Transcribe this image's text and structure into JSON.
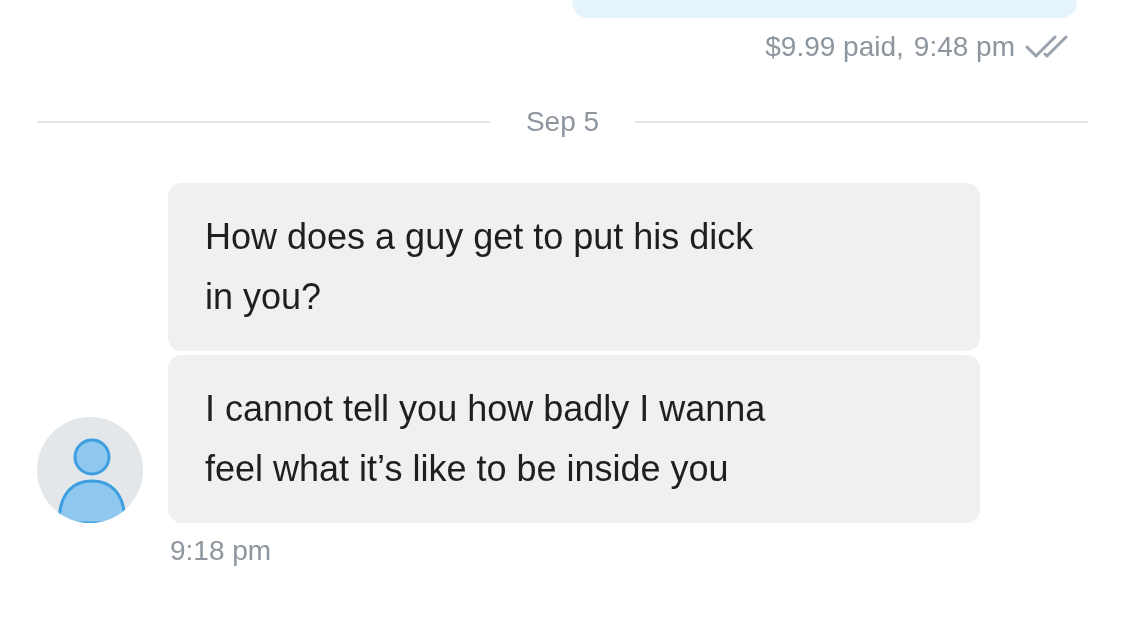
{
  "outgoing": {
    "price": "$9.99 paid,",
    "time": "9:48 pm",
    "read": true
  },
  "date_divider": "Sep 5",
  "incoming": {
    "messages": [
      {
        "lines": [
          "How does a guy get to put his dick",
          "in you?"
        ]
      },
      {
        "lines": [
          "I cannot tell you how badly I wanna",
          "feel what it’s like to be inside you"
        ]
      }
    ],
    "time": "9:18 pm"
  }
}
